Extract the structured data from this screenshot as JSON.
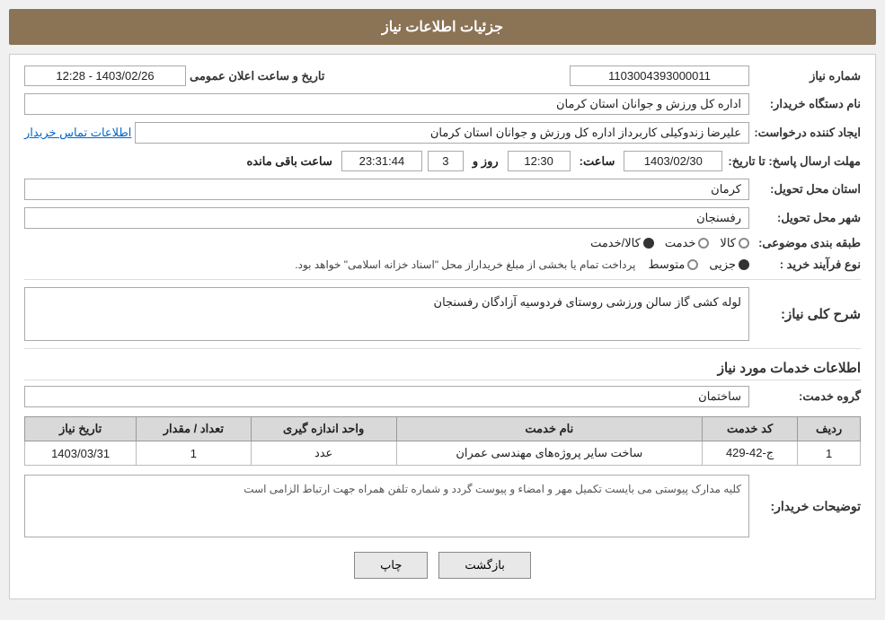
{
  "page": {
    "title": "جزئیات اطلاعات نیاز"
  },
  "header": {
    "label": "شماره نیاز",
    "value": "1103004393000011",
    "date_label": "تاریخ و ساعت اعلان عمومی",
    "date_value": "1403/02/26 - 12:28"
  },
  "form": {
    "buyer_org_label": "نام دستگاه خریدار:",
    "buyer_org_value": "اداره کل ورزش و جوانان استان کرمان",
    "requester_label": "ایجاد کننده درخواست:",
    "requester_value": "علیرضا  زندوکیلی  کاربرداز اداره کل ورزش و جوانان استان کرمان",
    "contact_link": "اطلاعات تماس خریدار",
    "deadline_label": "مهلت ارسال پاسخ: تا تاریخ:",
    "deadline_date": "1403/02/30",
    "deadline_time_label": "ساعت:",
    "deadline_time": "12:30",
    "deadline_days_label": "روز و",
    "deadline_days": "3",
    "deadline_remaining_label": "ساعت باقی مانده",
    "deadline_remaining": "23:31:44",
    "delivery_province_label": "استان محل تحویل:",
    "delivery_province": "کرمان",
    "delivery_city_label": "شهر محل تحویل:",
    "delivery_city": "رفسنجان",
    "category_label": "طبقه بندی موضوعی:",
    "category_options": [
      "کالا",
      "خدمت",
      "کالا/خدمت"
    ],
    "category_selected": "کالا",
    "purchase_type_label": "نوع فرآیند خرید :",
    "purchase_options": [
      "جزیی",
      "متوسط"
    ],
    "purchase_note": "پرداخت تمام یا بخشی از مبلغ خریداراز محل \"اسناد خزانه اسلامی\" خواهد بود.",
    "description_label": "شرح کلی نیاز:",
    "description_value": "لوله کشی گاز سالن ورزشی روستای فردوسیه آزادگان رفسنجان",
    "services_section_title": "اطلاعات خدمات مورد نیاز",
    "service_group_label": "گروه خدمت:",
    "service_group_value": "ساختمان",
    "table": {
      "columns": [
        "ردیف",
        "کد خدمت",
        "نام خدمت",
        "واحد اندازه گیری",
        "تعداد / مقدار",
        "تاریخ نیاز"
      ],
      "rows": [
        {
          "row": "1",
          "code": "ج-42-429",
          "name": "ساخت سایر پروژه‌های مهندسی عمران",
          "unit": "عدد",
          "quantity": "1",
          "date": "1403/03/31"
        }
      ]
    },
    "buyer_notes_label": "توضیحات خریدار:",
    "buyer_notes": "کلیه مدارک پیوستی می بایست تکمیل مهر و امضاء و پیوست گردد و شماره تلفن همراه جهت ارتباط الزامی است"
  },
  "buttons": {
    "print": "چاپ",
    "back": "بازگشت"
  }
}
